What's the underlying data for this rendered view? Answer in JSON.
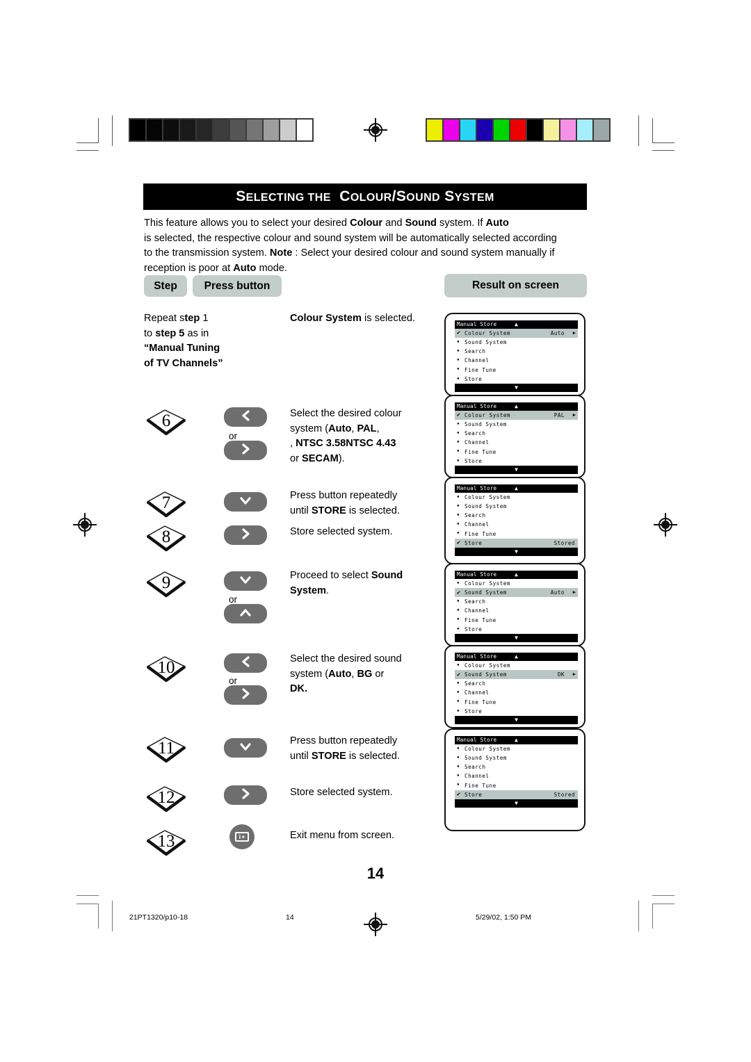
{
  "banner": {
    "title_pre": "Selecting the",
    "title_main": "Colour/Sound System"
  },
  "intro": {
    "l1_a": "This feature allows you to select your desired ",
    "l1_b": "Colour",
    "l1_c": " and ",
    "l1_d": "Sound",
    "l1_e": " system. If ",
    "l1_f": "Auto",
    "l2": "is selected, the respective colour and sound system will be automatically selected according",
    "l3_a": "to the transmission system. ",
    "l3_b": "Note",
    "l3_c": " : Select your desired colour and sound system manually if",
    "l4_a": "reception is poor at ",
    "l4_b": "Auto",
    "l4_c": " mode."
  },
  "table_headers": {
    "step": "Step",
    "press_button": "Press button",
    "result": "Result on screen"
  },
  "first_row": {
    "step_l1_a": "Repeat s",
    "step_l1_b": "tep",
    "step_l1_c": " 1",
    "step_l2_a": "to ",
    "step_l2_b": "step 5",
    "step_l2_c": " as in",
    "step_l3": "“Manual Tuning",
    "step_l4": "of TV Channels”",
    "desc_a": "Colour System",
    "desc_b": " is selected."
  },
  "steps": [
    {
      "number": "6",
      "buttons": [
        "chevron-left",
        "chevron-right"
      ],
      "or_label": "or",
      "desc_lines": [
        {
          "plain": "Select the desired colour"
        },
        {
          "plain": "system  (",
          "bold": "Auto",
          "plain2": ", ",
          "bold2": "PAL",
          "plain3": ","
        },
        {
          "bold": "NTSC 3.58",
          "plain": ", ",
          "bold2": "NTSC 4.43"
        },
        {
          "plain": "or ",
          "bold": "SECAM",
          "plain2": ")."
        }
      ]
    },
    {
      "number": "7",
      "buttons": [
        "chevron-down"
      ],
      "desc_lines": [
        {
          "plain": "Press button repeatedly"
        },
        {
          "plain": "until ",
          "bold": "STORE",
          "plain2": " is selected."
        }
      ]
    },
    {
      "number": "8",
      "buttons": [
        "chevron-right"
      ],
      "desc_lines": [
        {
          "plain": "Store selected system."
        }
      ]
    },
    {
      "number": "9",
      "buttons": [
        "chevron-down",
        "chevron-up"
      ],
      "or_label": "or",
      "desc_lines": [
        {
          "plain": "Proceed to select ",
          "bold": "Sound"
        },
        {
          "bold": "System",
          "plain2": "."
        }
      ]
    },
    {
      "number": "10",
      "buttons": [
        "chevron-left",
        "chevron-right"
      ],
      "or_label": "or",
      "desc_lines": [
        {
          "plain": "Select the desired sound"
        },
        {
          "plain": "system  (",
          "bold": "Auto",
          "plain2": ", ",
          "bold2": "BG",
          "plain3": " or"
        },
        {
          "bold": "DK."
        }
      ]
    },
    {
      "number": "11",
      "buttons": [
        "chevron-down"
      ],
      "desc_lines": [
        {
          "plain": "Press button repeatedly"
        },
        {
          "plain": "until ",
          "bold": "STORE",
          "plain2": " is selected."
        }
      ]
    },
    {
      "number": "12",
      "buttons": [
        "chevron-right"
      ],
      "desc_lines": [
        {
          "plain": "Store selected system."
        }
      ]
    },
    {
      "number": "13",
      "buttons": [
        "menu-info"
      ],
      "desc_lines": [
        {
          "plain": "Exit menu from screen."
        }
      ]
    }
  ],
  "osd_menus": [
    {
      "title": "Manual Store",
      "up_arrow": "▲",
      "down_arrow": "▼",
      "rows": [
        {
          "mark": "check",
          "label": "Colour System",
          "value": "Auto",
          "arrow": "▶",
          "selected": true
        },
        {
          "mark": "bullet",
          "label": "Sound System",
          "value": "",
          "selected": false
        },
        {
          "mark": "bullet",
          "label": "Search",
          "value": "",
          "selected": false
        },
        {
          "mark": "bullet",
          "label": "Channel",
          "value": "",
          "selected": false
        },
        {
          "mark": "bullet",
          "label": "Fine Tune",
          "value": "",
          "selected": false
        },
        {
          "mark": "bullet",
          "label": "Store",
          "value": "",
          "selected": false
        }
      ]
    },
    {
      "title": "Manual Store",
      "up_arrow": "▲",
      "down_arrow": "▼",
      "rows": [
        {
          "mark": "check",
          "label": "Colour System",
          "value": "PAL",
          "arrow": "▶",
          "selected": true
        },
        {
          "mark": "bullet",
          "label": "Sound System",
          "value": "",
          "selected": false
        },
        {
          "mark": "bullet",
          "label": "Search",
          "value": "",
          "selected": false
        },
        {
          "mark": "bullet",
          "label": "Channel",
          "value": "",
          "selected": false
        },
        {
          "mark": "bullet",
          "label": "Fine Tune",
          "value": "",
          "selected": false
        },
        {
          "mark": "bullet",
          "label": "Store",
          "value": "",
          "selected": false
        }
      ]
    },
    {
      "title": "Manual Store",
      "up_arrow": "▲",
      "down_arrow": "▼",
      "rows": [
        {
          "mark": "bullet",
          "label": "Colour System",
          "value": "",
          "selected": false
        },
        {
          "mark": "bullet",
          "label": "Sound System",
          "value": "",
          "selected": false
        },
        {
          "mark": "bullet",
          "label": "Search",
          "value": "",
          "selected": false
        },
        {
          "mark": "bullet",
          "label": "Channel",
          "value": "",
          "selected": false
        },
        {
          "mark": "bullet",
          "label": "Fine Tune",
          "value": "",
          "selected": false
        },
        {
          "mark": "check",
          "label": "Store",
          "value": "Stored",
          "selected": true
        }
      ]
    },
    {
      "title": "Manual Store",
      "up_arrow": "▲",
      "down_arrow": "▼",
      "rows": [
        {
          "mark": "bullet",
          "label": "Colour System",
          "value": "",
          "selected": false
        },
        {
          "mark": "check",
          "label": "Sound System",
          "value": "Auto",
          "arrow": "▶",
          "selected": true
        },
        {
          "mark": "bullet",
          "label": "Search",
          "value": "",
          "selected": false
        },
        {
          "mark": "bullet",
          "label": "Channel",
          "value": "",
          "selected": false
        },
        {
          "mark": "bullet",
          "label": "Fine Tune",
          "value": "",
          "selected": false
        },
        {
          "mark": "bullet",
          "label": "Store",
          "value": "",
          "selected": false
        }
      ]
    },
    {
      "title": "Manual Store",
      "up_arrow": "▲",
      "down_arrow": "▼",
      "rows": [
        {
          "mark": "bullet",
          "label": "Colour System",
          "value": "",
          "selected": false
        },
        {
          "mark": "check",
          "label": "Sound System",
          "value": "DK",
          "arrow": "▶",
          "selected": true
        },
        {
          "mark": "bullet",
          "label": "Search",
          "value": "",
          "selected": false
        },
        {
          "mark": "bullet",
          "label": "Channel",
          "value": "",
          "selected": false
        },
        {
          "mark": "bullet",
          "label": "Fine Tune",
          "value": "",
          "selected": false
        },
        {
          "mark": "bullet",
          "label": "Store",
          "value": "",
          "selected": false
        }
      ]
    },
    {
      "title": "Manual Store",
      "up_arrow": "▲",
      "down_arrow": "▼",
      "rows": [
        {
          "mark": "bullet",
          "label": "Colour System",
          "value": "",
          "selected": false
        },
        {
          "mark": "bullet",
          "label": "Sound System",
          "value": "",
          "selected": false
        },
        {
          "mark": "bullet",
          "label": "Search",
          "value": "",
          "selected": false
        },
        {
          "mark": "bullet",
          "label": "Channel",
          "value": "",
          "selected": false
        },
        {
          "mark": "bullet",
          "label": "Fine Tune",
          "value": "",
          "selected": false
        },
        {
          "mark": "check",
          "label": "Store",
          "value": "Stored",
          "selected": true
        }
      ]
    }
  ],
  "page_number": "14",
  "footer": {
    "file": "21PT1320/p10-18",
    "page": "14",
    "timestamp": "5/29/02, 1:50 PM"
  },
  "colors": {
    "pill_bg": "#c3cdc9",
    "button_bg": "#6e6e6e",
    "osd_selected_bg": "#b9c7c4",
    "banner_bg": "#000000"
  },
  "grey_strip": [
    "#000000",
    "#050505",
    "#0d0d0d",
    "#1a1a1a",
    "#262626",
    "#3d3d3d",
    "#565656",
    "#757575",
    "#9e9e9e",
    "#cccccc",
    "#ffffff"
  ],
  "color_strip": [
    "#eded00",
    "#ea00ea",
    "#2ad4f5",
    "#1a00b0",
    "#00d400",
    "#ed0000",
    "#000000",
    "#f5f09b",
    "#f791e8",
    "#a5eefc",
    "#9aa8a8"
  ]
}
